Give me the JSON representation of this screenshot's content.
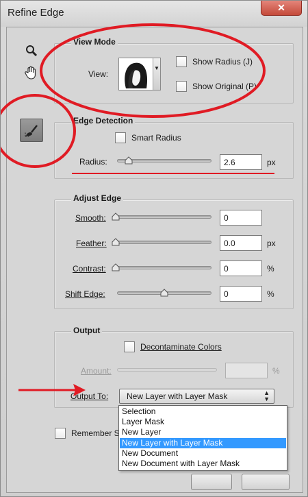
{
  "window": {
    "title": "Refine Edge",
    "close_label": "✕"
  },
  "tools": [
    {
      "icon": "zoom-icon"
    },
    {
      "icon": "hand-icon"
    },
    {
      "icon": "refine-radius-brush-icon"
    }
  ],
  "view_mode": {
    "title": "View Mode",
    "view_label": "View:",
    "show_radius_label": "Show Radius (J)",
    "show_original_label": "Show Original (P)",
    "show_radius_checked": false,
    "show_original_checked": false
  },
  "edge_detection": {
    "title": "Edge Detection",
    "smart_radius_label": "Smart Radius",
    "smart_radius_checked": false,
    "radius_label": "Radius:",
    "radius_value": "2.6",
    "radius_unit": "px",
    "radius_slider_fraction": 0.1
  },
  "adjust_edge": {
    "title": "Adjust Edge",
    "rows": [
      {
        "label": "Smooth:",
        "value": "0",
        "unit": "",
        "slider_fraction": 0.0
      },
      {
        "label": "Feather:",
        "value": "0.0",
        "unit": "px",
        "slider_fraction": 0.0
      },
      {
        "label": "Contrast:",
        "value": "0",
        "unit": "%",
        "slider_fraction": 0.0
      },
      {
        "label": "Shift Edge:",
        "value": "0",
        "unit": "%",
        "slider_fraction": 0.5
      }
    ]
  },
  "output": {
    "title": "Output",
    "decontaminate_label": "Decontaminate Colors",
    "decontaminate_checked": false,
    "amount_label": "Amount:",
    "amount_value": "",
    "amount_unit": "%",
    "output_to_label": "Output To:",
    "output_to_value": "New Layer with Layer Mask",
    "options": [
      "Selection",
      "Layer Mask",
      "New Layer",
      "New Layer with Layer Mask",
      "New Document",
      "New Document with Layer Mask"
    ],
    "selected_option": "New Layer with Layer Mask"
  },
  "remember_settings": {
    "label": "Remember S",
    "checked": false
  },
  "annotations": {
    "circle_color": "#e01b24",
    "arrow_color": "#e01b24"
  }
}
